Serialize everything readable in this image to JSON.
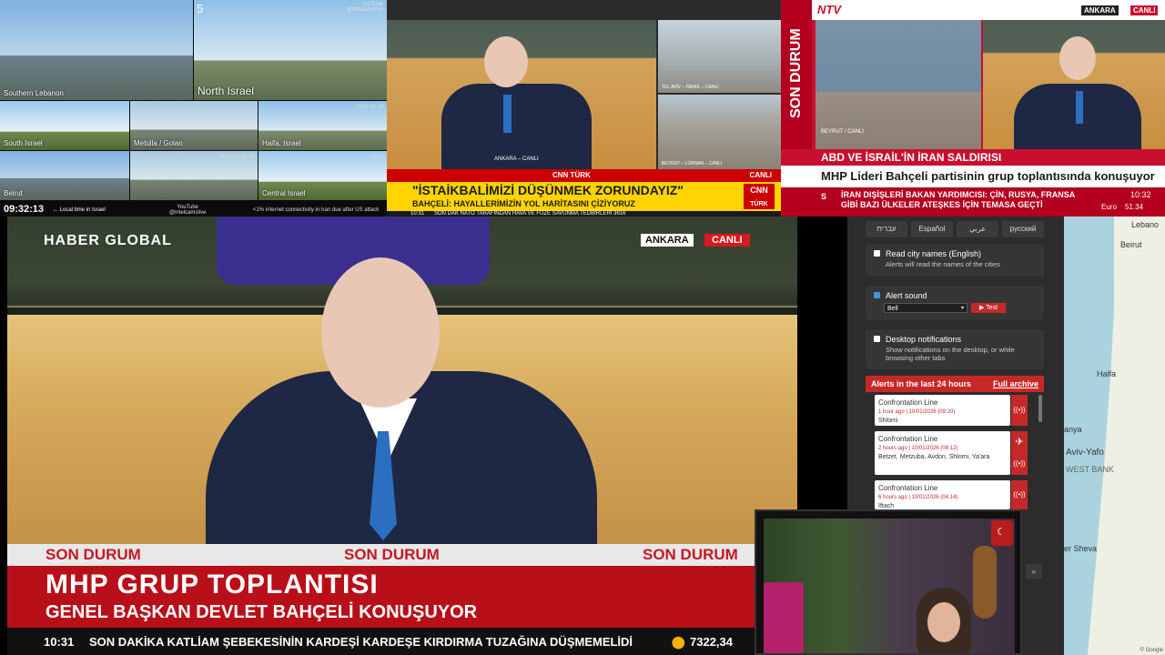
{
  "cctv": {
    "cam_number": "5",
    "youtube_top": "YouTube\n@intelcamslive",
    "labels": [
      "Southern Lebanon",
      "North Israel",
      "South Israel",
      "Metulla / Golan",
      "Haifa, Israel",
      "Beirut",
      "Central Israel"
    ],
    "timestamps": [
      "2026-01-10",
      "04.2.1 / 10:07",
      "10:07"
    ],
    "time": "09:32:13",
    "local_time_caption": "← Local time in Israel",
    "youtube_bottom": "YouTube\n@intelcamslive",
    "internet_note": "<1% internet connectivity in Iran due after US attack"
  },
  "cnn": {
    "network": "CNN TÜRK",
    "live": "CANLI",
    "location_main": "ANKARA – CANLI",
    "loc_tel_aviv": "TEL AVİV – İSRAİL – CANLI",
    "loc_beirut": "BEYRUT – LÜBNAN – CANLI",
    "headline": "\"İSTAİKBALİMİZİ DÜŞÜNMEK ZORUNDAYIZ\"",
    "subheadline": "BAHÇELİ: HAYALLERİMİZİN YOL HARİTASINI ÇİZİYORUZ",
    "ticker_time": "10:31",
    "ticker": "SON DAK  NATO TARAFINDAN HAVA VE FÜZE SAVUNMA TEDBİRLERİ  3616"
  },
  "ntv": {
    "logo": "NTV",
    "side": "SON DURUM",
    "tag_city": "ANKARA",
    "tag_live": "CANLI",
    "beyrut": "BEYRUT / CANLI",
    "headline": "ABD VE İSRAİL'İN İRAN SALDIRISI",
    "sub": "MHP Lideri Bahçeli partisinin grup toplantısında konuşuyor",
    "ticker_s": "S",
    "ticker": "İRAN DIŞİŞLERİ BAKAN YARDIMCISI: ÇİN, RUSYA, FRANSA GİBİ BAZI ÜLKELER ATEŞKES İÇİN TEMASA GEÇTİ",
    "time": "10:32",
    "euro_label": "Euro",
    "euro_value": "51.34"
  },
  "haber_global": {
    "logo": "HABER GLOBAL",
    "tag_city": "ANKARA",
    "tag_live": "CANLI",
    "son_durum": "SON DURUM",
    "title": "MHP GRUP TOPLANTISI",
    "subtitle": "GENEL BAŞKAN DEVLET BAHÇELİ KONUŞUYOR",
    "ticker_time": "10:31",
    "ticker": "SON DAKİKA  KATLİAM ŞEBEKESİNİN KARDEŞİ KARDEŞE KIRDIRMA TUZAĞINA DÜŞMEMELİDİ",
    "market_value": "7322,34"
  },
  "panel": {
    "languages": [
      "עברית",
      "Español",
      "عربي",
      "русский"
    ],
    "read_city": {
      "title": "Read city names (English)",
      "desc": "Alerts will read the names of the cities"
    },
    "alert_sound": {
      "title": "Alert sound",
      "selected": "Bell",
      "test": "▶ Test"
    },
    "desktop": {
      "title": "Desktop notifications",
      "desc": "Show notifications on the desktop, or while browsing other tabs"
    },
    "alerts_header": "Alerts in the last 24 hours",
    "full_archive": "Full archive",
    "alerts": [
      {
        "name": "Confrontation Line",
        "time": "1 hour ago | 10/01/2026 (09:20)",
        "cities": "Shlomi"
      },
      {
        "name": "Confrontation Line",
        "time": "2 hours ago | 10/01/2026 (08:12)",
        "cities": "Betzet, Metzuba, Avdon, Shlomi, Ya'ara"
      },
      {
        "name": "Confrontation Line",
        "time": "6 hours ago | 10/01/2026 (04:14)",
        "cities": "Iftach"
      }
    ]
  },
  "map": {
    "labels": [
      "Lebano",
      "Beirut",
      "Haifa",
      "Aviv-Yafo",
      "WEST BANK",
      "er Sheva",
      "anya"
    ],
    "attribution": "© Google"
  }
}
